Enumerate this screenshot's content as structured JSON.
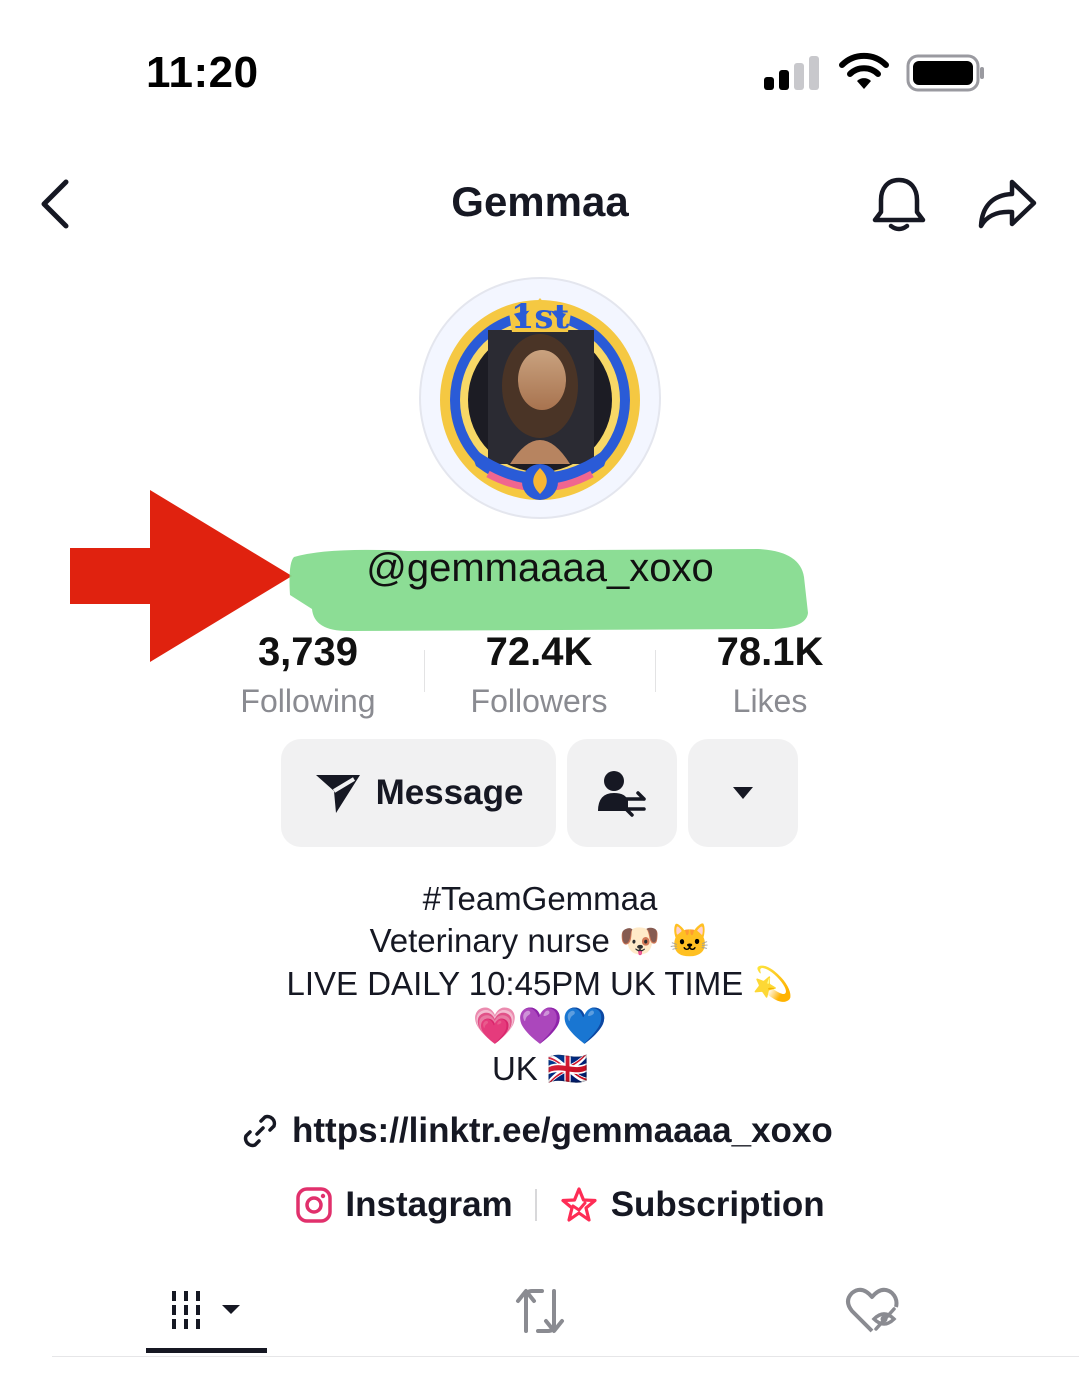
{
  "status_bar": {
    "time": "11:20"
  },
  "header": {
    "title": "Gemmaa"
  },
  "profile": {
    "avatar_badge": "1st",
    "username": "@gemmaaaa_xoxo"
  },
  "stats": [
    {
      "value": "3,739",
      "label": "Following"
    },
    {
      "value": "72.4K",
      "label": "Followers"
    },
    {
      "value": "78.1K",
      "label": "Likes"
    }
  ],
  "actions": {
    "message_label": "Message"
  },
  "bio": {
    "line1": "#TeamGemmaa",
    "line2": "Veterinary nurse 🐶 🐱",
    "line3": "LIVE DAILY 10:45PM UK TIME 💫",
    "line4": "💗💜💙",
    "line5": "UK 🇬🇧"
  },
  "link": {
    "url": "https://linktr.ee/gemmaaaa_xoxo"
  },
  "social": {
    "instagram_label": "Instagram",
    "subscription_label": "Subscription"
  },
  "colors": {
    "annotation_arrow": "#e0220f",
    "highlight": "#7fd98a",
    "instagram": "#e1306c",
    "subscription": "#fe2c55"
  },
  "icons": {
    "back": "chevron-left-icon",
    "bell": "bell-icon",
    "share": "share-arrow-icon",
    "message": "send-icon",
    "friend": "user-swap-icon",
    "more": "caret-down-icon",
    "link": "link-icon",
    "instagram": "instagram-icon",
    "subscription": "star-badge-icon",
    "tab_videos": "grid-icon",
    "tab_reposts": "repost-icon",
    "tab_liked": "hidden-heart-icon"
  }
}
